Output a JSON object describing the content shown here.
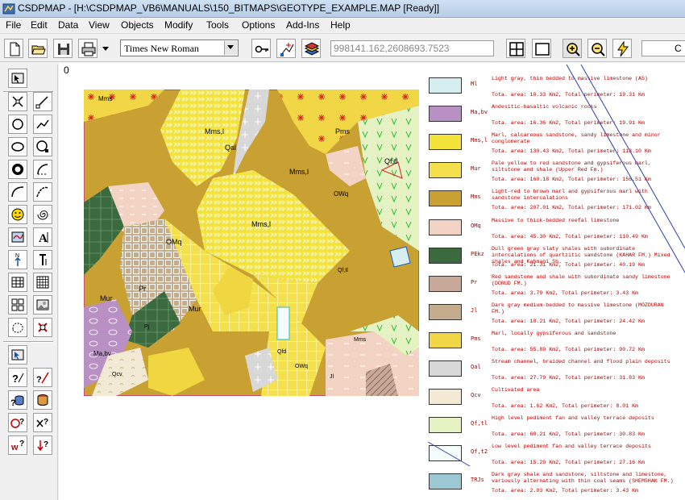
{
  "window": {
    "title": "CSDPMAP - [H:\\CSDPMAP_VB6\\MANUALS\\150_BITMAPS\\GEOTYPE_EXAMPLE.MAP [Ready]]"
  },
  "menu": [
    "File",
    "Edit",
    "Data",
    "View",
    "Objects",
    "Modify",
    "Tools",
    "Options",
    "Add-Ins",
    "Help"
  ],
  "toolbar": {
    "font_value": "Times New Roman",
    "coordinates": "998141.162,2608693.7523",
    "cut_text": "C"
  },
  "canvas": {
    "origin_label": "0"
  },
  "map_labels": [
    {
      "t": "Mms"
    },
    {
      "t": "Mms,l"
    },
    {
      "t": "Qal"
    },
    {
      "t": "Pms"
    },
    {
      "t": "Mms,l"
    },
    {
      "t": "Qf,tl"
    },
    {
      "t": "OWq"
    },
    {
      "t": "Mms,l"
    },
    {
      "t": "OMq"
    },
    {
      "t": "Mur"
    },
    {
      "t": "Pr"
    },
    {
      "t": "Mur"
    },
    {
      "t": "Pj"
    },
    {
      "t": "Ma,bv"
    },
    {
      "t": "Qcv"
    },
    {
      "t": "Qfd"
    },
    {
      "t": "OWq"
    },
    {
      "t": "Jl"
    },
    {
      "t": "Qf,tl"
    },
    {
      "t": "Mms"
    }
  ],
  "legend": [
    {
      "code": "Ml",
      "desc": "Light gray, thin bedded to massive limestone (AS)",
      "area": "Tota. area: 10.33 Km2, Total perimeter: 19.31 Km",
      "color": "#d6eef0"
    },
    {
      "code": "Ma,bv",
      "desc": "Andesitic-basaltic volcanic rocks",
      "area": "Tota. area: 16.36 Km2, Total perimeter: 19.91 Km",
      "color": "#b890c4"
    },
    {
      "code": "Mms,l",
      "desc": "Marl, calcareous sandstone, sandy limestone and minor conglomerate",
      "area": "Tota. area: 130.43 Km2, Total perimeter: 113.10 Km",
      "color": "#f2e23a"
    },
    {
      "code": "Mur",
      "desc": "Pale yellow to red sandstone and gypsiferous marl, siltstone and shale (Upper Red Fm.)",
      "area": "Tota. area: 160.18 Km2, Total perimeter: 156.51 Km",
      "color": "#f3e04c"
    },
    {
      "code": "Mms",
      "desc": "Light-red to brown marl and gypsiferous marl with sandstone intercalations",
      "area": "Tota. area: 207.01 Km2, Total perimeter: 171.02 Km",
      "color": "#c9a032"
    },
    {
      "code": "OMq",
      "desc": "Massive to thick-bedded reefal limestone",
      "area": "Tota. area: 45.30 Km2, Total perimeter: 110.49 Km",
      "color": "#f3d4c4"
    },
    {
      "code": "PEkz",
      "desc": "Dull green gray slaty shales with subordinate intercalations of quartzitic sandstone (KAHAR FM.) Mixed shales and Kahmani Sh.",
      "area": "Tota. area: 21.31 Km2, Total perimeter: 40.19 Km",
      "color": "#3a6a3e"
    },
    {
      "code": "Pr",
      "desc": "Red sandstone and shale with subordinate sandy limestone (DORUD FM.)",
      "area": "Tota. area: 3.79 Km2, Total perimeter: 3.43 Km",
      "color": "#c8a898"
    },
    {
      "code": "Jl",
      "desc": "Dark gray medium-bedded to massive limestone (MOZDURAN FM.)",
      "area": "Tota. area: 18.21 Km2, Total perimeter: 24.42 Km",
      "color": "#c4ac8c"
    },
    {
      "code": "Pms",
      "desc": "Marl, locally gypsiferous and sandstone",
      "area": "Tota. area: 55.89 Km2, Total perimeter: 90.72 Km",
      "color": "#f1d646"
    },
    {
      "code": "Qal",
      "desc": "Stream channel, braided channel and flood plain deposits",
      "area": "Tota. area: 27.79 Km2, Total perimeter: 31.83 Km",
      "color": "#d8d8d8"
    },
    {
      "code": "Qcv",
      "desc": "Cultivated area",
      "area": "Tota. area: 1.62 Km2, Total perimeter: 8.01 Km",
      "color": "#f2ead4"
    },
    {
      "code": "Qf,tl",
      "desc": "High level pediment fan and valley terrace deposits",
      "area": "Tota. area: 60.21 Km2, Total perimeter: 30.83 Km",
      "color": "#e4f2c4"
    },
    {
      "code": "Qf,t2",
      "desc": "Low level pediment fan and valley terrace deposits",
      "area": "Tota. area: 15.29 Km2, Total perimeter: 27.16 Km",
      "color": "#f4fcfc"
    },
    {
      "code": "TRJs",
      "desc": "Dark gray shale and sandstone, siltstone and limestone, variously alternating with thin coal seams (SHEMSHAK FM.)",
      "area": "Tota. area: 2.03 Km2, Total perimeter: 3.43 Km",
      "color": "#9cc8d4"
    }
  ]
}
